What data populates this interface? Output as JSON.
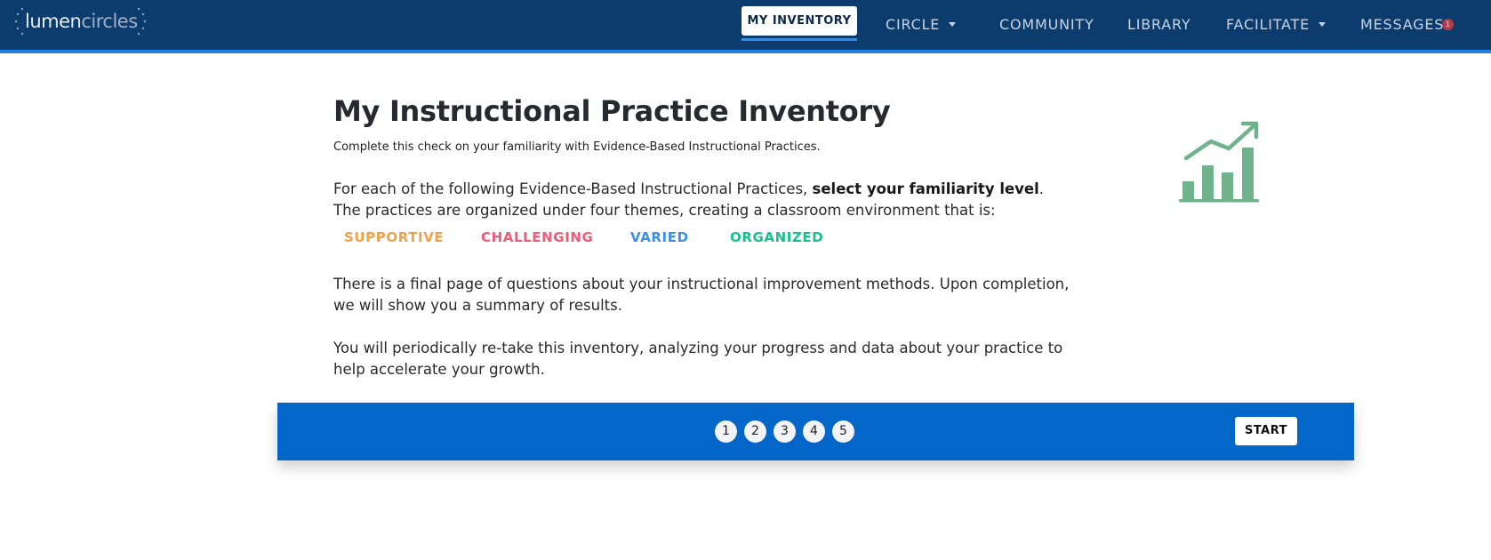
{
  "header": {
    "logo": {
      "part1": "lumen",
      "part2": "circles"
    },
    "nav": [
      {
        "label": "MY INVENTORY",
        "active": true,
        "dropdown": false
      },
      {
        "label": "CIRCLE",
        "active": false,
        "dropdown": true
      },
      {
        "label": "COMMUNITY",
        "active": false,
        "dropdown": false
      },
      {
        "label": "LIBRARY",
        "active": false,
        "dropdown": false
      },
      {
        "label": "FACILITATE",
        "active": false,
        "dropdown": true
      },
      {
        "label": "MESSAGES",
        "active": false,
        "dropdown": false
      }
    ],
    "messages_badge": "1"
  },
  "main": {
    "title": "My Instructional Practice Inventory",
    "subtitle": "Complete this check on your familiarity with Evidence-Based Instructional Practices.",
    "intro_before": "For each of the following Evidence-Based Instructional Practices, ",
    "intro_bold": "select your familiarity level",
    "intro_after": ". The practices are organized under four themes, creating a classroom environment that is:",
    "themes": [
      {
        "label": "SUPPORTIVE",
        "color": "#f0a24a"
      },
      {
        "label": "CHALLENGING",
        "color": "#ee5a78"
      },
      {
        "label": "VARIED",
        "color": "#3d8fe6"
      },
      {
        "label": "ORGANIZED",
        "color": "#19c08a"
      }
    ],
    "paragraph_2": "There is a final page of questions about your instructional improvement methods. Upon completion, we will show you a summary of results.",
    "paragraph_3": "You will periodically re-take this inventory, analyzing your progress and data about your practice to help accelerate your growth.",
    "icon": "growth-chart-icon",
    "icon_color": "#6fb28c"
  },
  "stepper": {
    "steps": [
      "1",
      "2",
      "3",
      "4",
      "5"
    ],
    "start_label": "START",
    "bar_color": "#0466c8"
  }
}
